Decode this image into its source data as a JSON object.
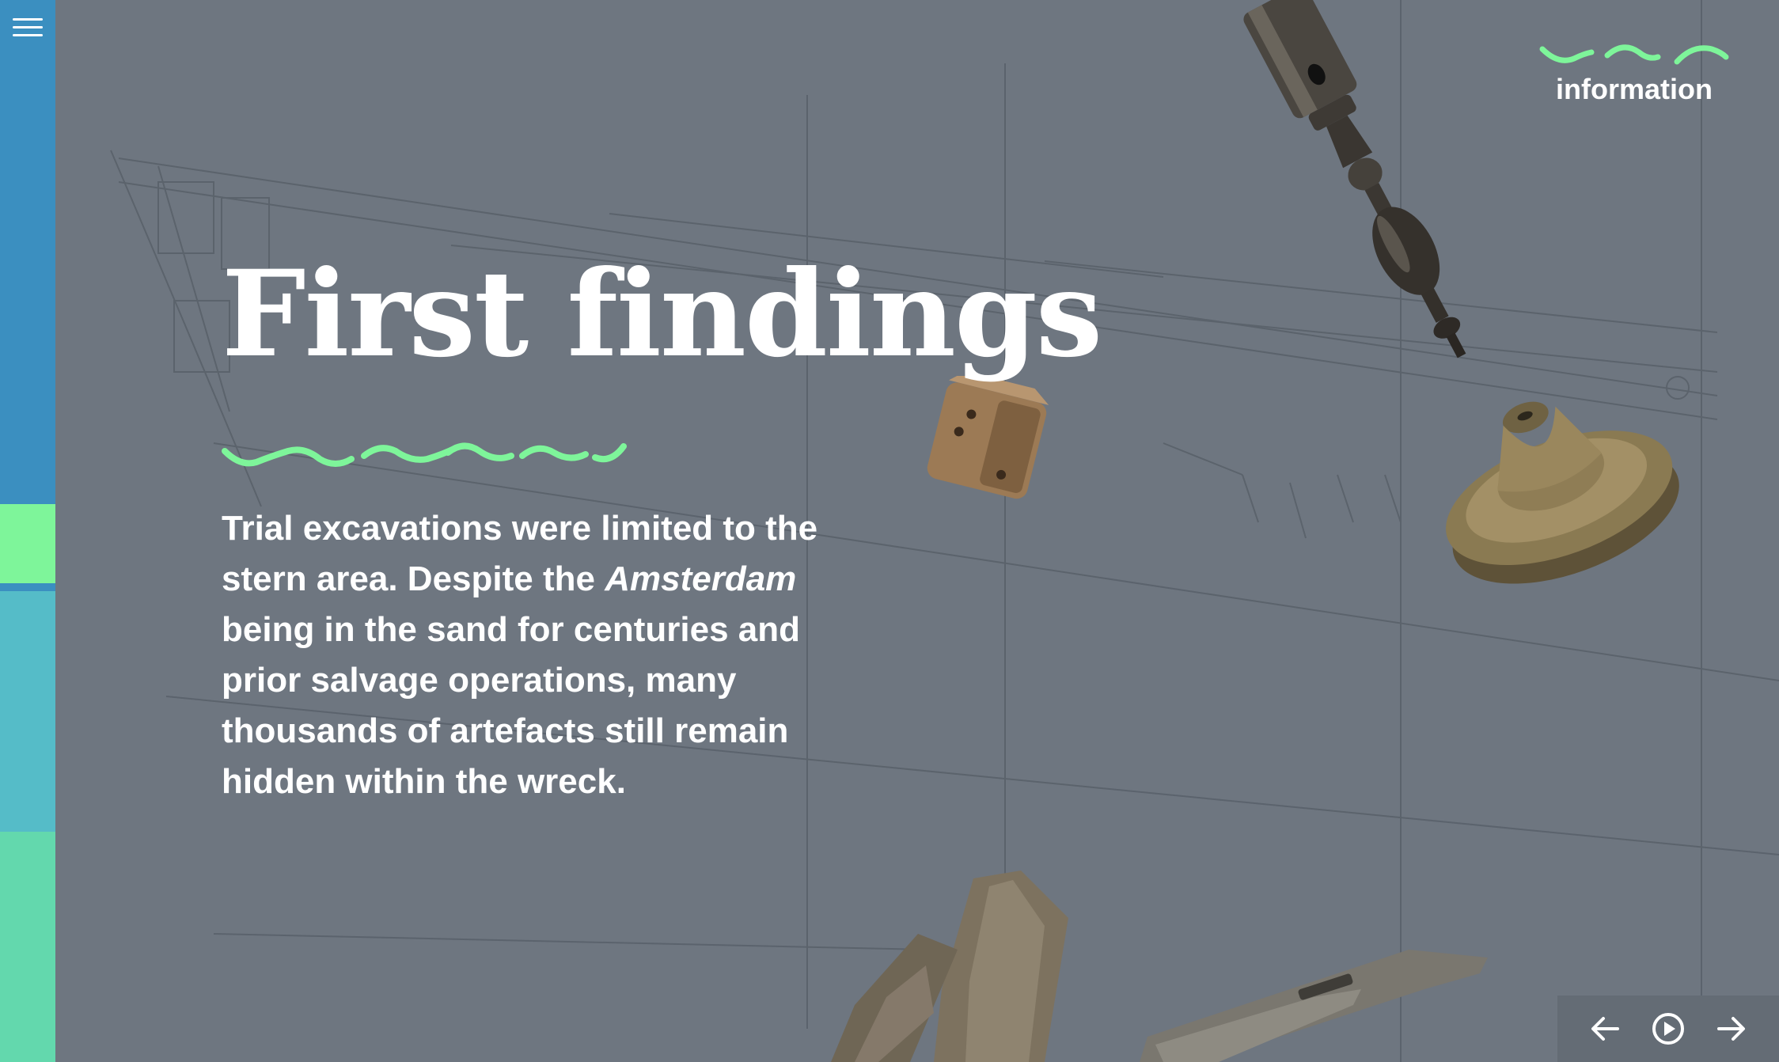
{
  "slide": {
    "title": "First findings",
    "body_before": "Trial excavations were limited to the stern area. Despite the ",
    "body_italic": "Amsterdam",
    "body_after": " being in the sand for centuries and prior salvage operations, many thousands of artefacts still remain hidden within the wreck."
  },
  "info_button": {
    "label": "information"
  },
  "colors": {
    "background": "#6e7680",
    "accent_green": "#7ef59a",
    "rail_blue": "#3b8fc0",
    "rail_teal": "#55bcc8",
    "rail_mint": "#63d8ad"
  },
  "icons": {
    "menu": "hamburger-menu-icon",
    "prev": "arrow-left-icon",
    "play": "play-circle-icon",
    "next": "arrow-right-icon"
  }
}
